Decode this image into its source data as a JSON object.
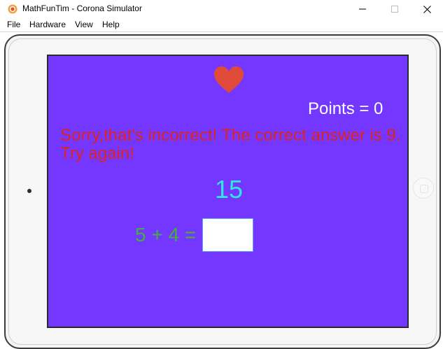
{
  "window": {
    "title": "MathFunTim - Corona Simulator",
    "minimize_glyph": "—",
    "maximize_glyph": "☐",
    "close_glyph": "✕"
  },
  "menu": {
    "items": [
      {
        "label": "File"
      },
      {
        "label": "Hardware"
      },
      {
        "label": "View"
      },
      {
        "label": "Help"
      }
    ]
  },
  "game": {
    "lives_icon": "heart-icon",
    "points_text": "Points = 0",
    "message": "Sorry,that's incorrect! The correct answer is 9. Try again!",
    "timer": "15",
    "question": "5 + 4 =",
    "answer_value": ""
  },
  "colors": {
    "screen_background": "#7337ff",
    "heart": "#e04a38",
    "points": "#ffffff",
    "message": "#dd2222",
    "timer": "#32e6e6",
    "question": "#44b03c"
  }
}
